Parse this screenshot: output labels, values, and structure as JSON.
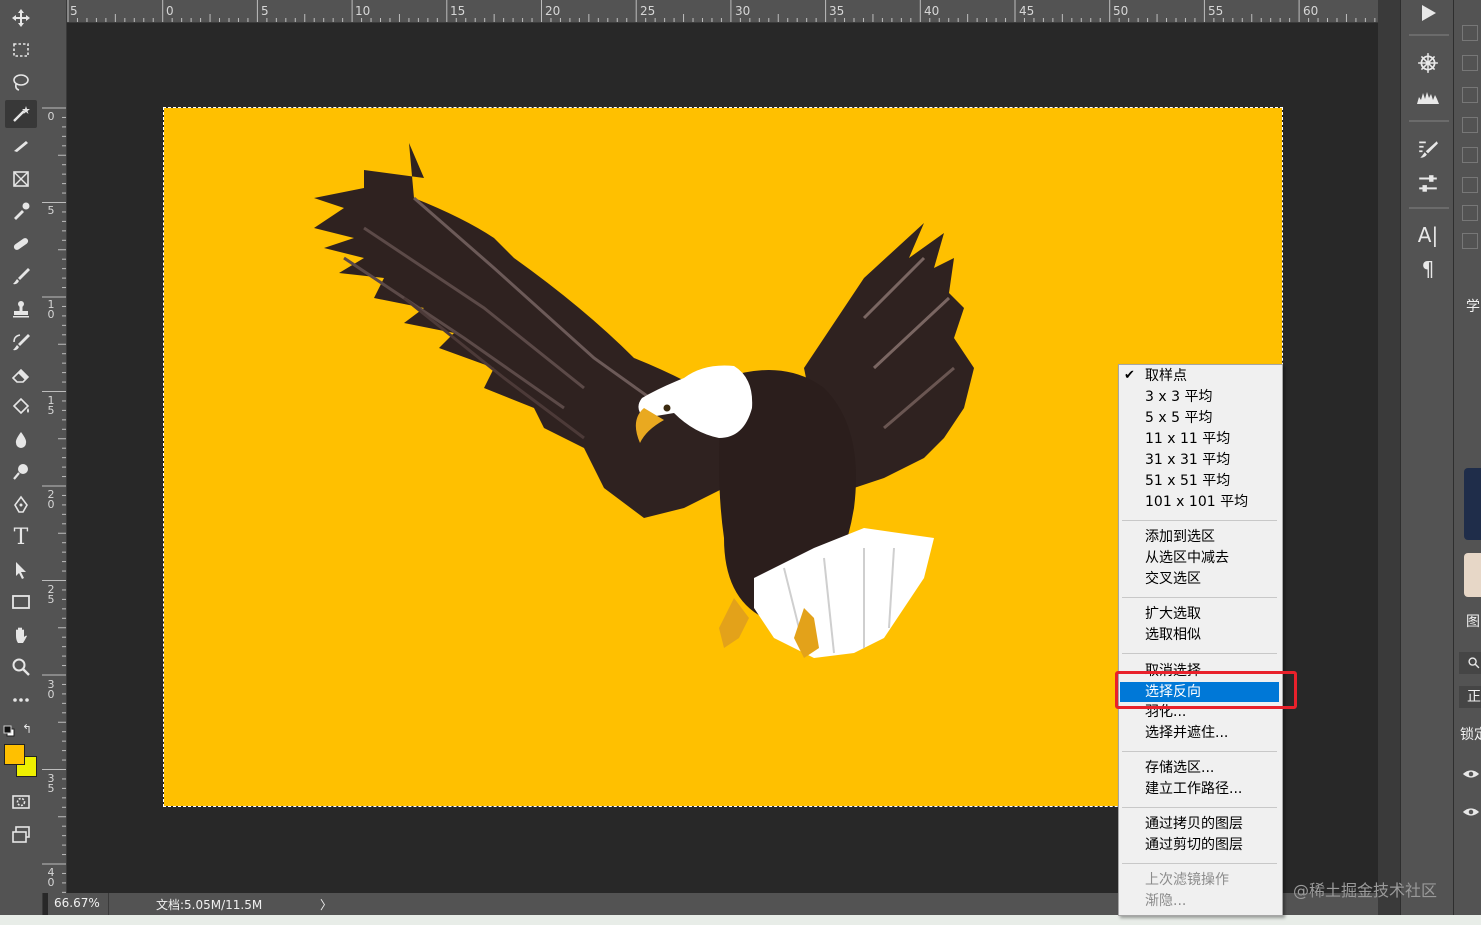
{
  "ruler": {
    "top_ticks": [
      "5",
      "0",
      "5",
      "10",
      "15",
      "20",
      "25",
      "30",
      "35",
      "40",
      "45",
      "50",
      "55",
      "60"
    ],
    "left_ticks": [
      "0",
      "5",
      "1 0",
      "1 5",
      "2 0",
      "2 5",
      "3 0",
      "3 5",
      "4 0"
    ]
  },
  "toolbar": {
    "tools": [
      "move-tool",
      "marquee-tool",
      "lasso-tool",
      "magic-wand-tool",
      "pen-slice-tool",
      "frame-tool",
      "eyedropper-tool",
      "healing-tool",
      "brush-tool",
      "stamp-tool",
      "history-brush-tool",
      "eraser-tool",
      "paint-bucket-tool",
      "blur-tool",
      "dodge-tool",
      "pen-tool",
      "type-tool",
      "path-selection-tool",
      "rectangle-tool",
      "hand-tool",
      "zoom-tool",
      "more-tools"
    ],
    "foreground_color": "#ffc000",
    "background_color": "#eef000"
  },
  "status": {
    "zoom": "66.67%",
    "doc_size": "文档:5.05M/11.5M",
    "arrow": "〉"
  },
  "context_menu": {
    "items": [
      {
        "label": "取样点",
        "checked": true
      },
      {
        "label": "3 x 3 平均"
      },
      {
        "label": "5 x 5 平均"
      },
      {
        "label": "11 x 11 平均"
      },
      {
        "label": "31 x 31 平均"
      },
      {
        "label": "51 x 51 平均"
      },
      {
        "label": "101 x 101 平均"
      },
      {
        "label": "添加到选区"
      },
      {
        "label": "从选区中减去"
      },
      {
        "label": "交叉选区"
      },
      {
        "label": "扩大选取"
      },
      {
        "label": "选取相似"
      },
      {
        "label": "取消选择"
      },
      {
        "label": "选择反向",
        "highlighted": true
      },
      {
        "label": "羽化..."
      },
      {
        "label": "选择并遮住..."
      },
      {
        "label": "存储选区..."
      },
      {
        "label": "建立工作路径..."
      },
      {
        "label": "通过拷贝的图层"
      },
      {
        "label": "通过剪切的图层"
      },
      {
        "label": "上次滤镜操作",
        "disabled": true
      },
      {
        "label": "渐隐...",
        "disabled": true
      }
    ]
  },
  "right_panel": {
    "icons": [
      "play-icon",
      "compass-icon",
      "histogram-icon",
      "brush-settings-icon",
      "adjust-icon",
      "character-icon",
      "paragraph-icon"
    ],
    "labels": [
      "学",
      "图",
      "正",
      "锁定"
    ]
  },
  "watermark": "@稀土掘金技术社区",
  "accent_color": "#0078d7",
  "canvas_color": "#ffc000"
}
